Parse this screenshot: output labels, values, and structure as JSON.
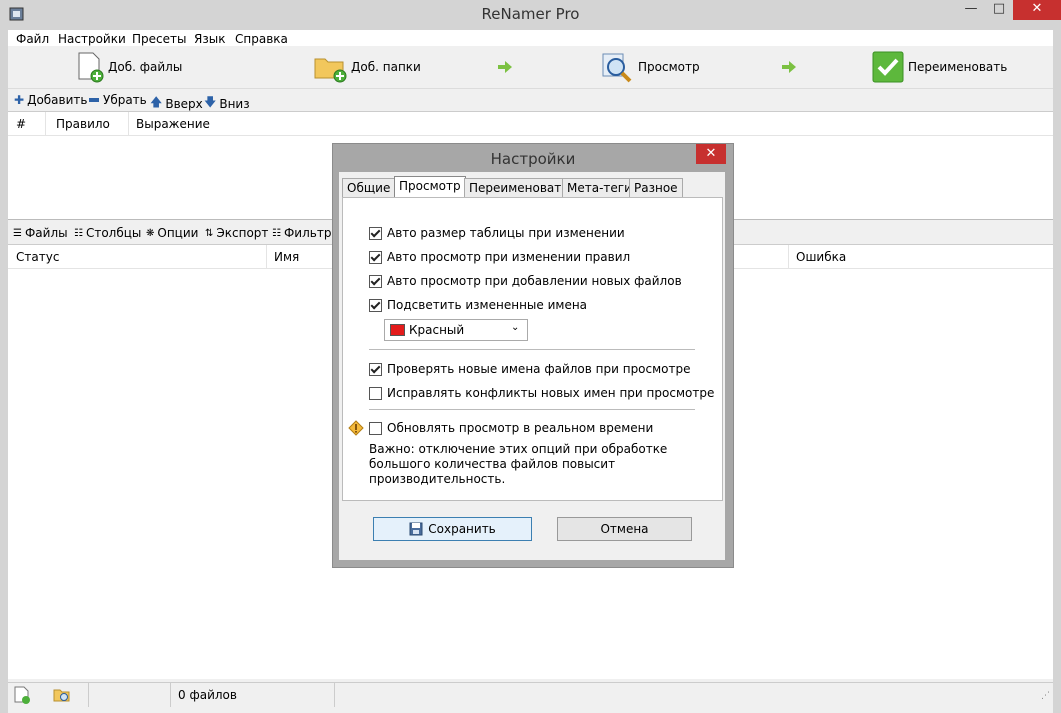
{
  "window": {
    "title": "ReNamer Pro"
  },
  "menu": [
    "Файл",
    "Настройки",
    "Пресеты",
    "Язык",
    "Справка"
  ],
  "toolbar": {
    "add_files": "Доб. файлы",
    "add_folders": "Доб. папки",
    "preview": "Просмотр",
    "rename": "Переименовать"
  },
  "rules_toolbar": {
    "add": "Добавить",
    "remove": "Убрать",
    "up": "Вверх",
    "down": "Вниз"
  },
  "rules_table": {
    "columns": [
      "#",
      "Правило",
      "Выражение"
    ]
  },
  "files_toolbar": {
    "files": "Файлы",
    "columns": "Столбцы",
    "options": "Опции",
    "export": "Экспорт",
    "filters": "Фильтры"
  },
  "files_table": {
    "columns": [
      "Статус",
      "Имя",
      "Ошибка"
    ]
  },
  "statusbar": {
    "count": "0 файлов"
  },
  "dialog": {
    "title": "Настройки",
    "tabs": [
      "Общие",
      "Просмотр",
      "Переименовать",
      "Мета-теги",
      "Разное"
    ],
    "active_tab": "Просмотр",
    "options": [
      {
        "label": "Авто размер таблицы при изменении",
        "checked": true
      },
      {
        "label": "Авто просмотр при изменении правил",
        "checked": true
      },
      {
        "label": "Авто просмотр при добавлении новых файлов",
        "checked": true
      },
      {
        "label": "Подсветить измененные имена",
        "checked": true
      },
      {
        "label": "Проверять новые имена файлов при просмотре",
        "checked": true
      },
      {
        "label": "Исправлять конфликты новых имен при просмотре",
        "checked": false
      },
      {
        "label": "Обновлять просмотр в реальном времени",
        "checked": false
      }
    ],
    "highlight_color": {
      "label": "Красный",
      "swatch": "#e31b1b"
    },
    "note": "Важно: отключение этих опций при обработке большого количества файлов повысит производительность.",
    "save": "Сохранить",
    "cancel": "Отмена"
  }
}
